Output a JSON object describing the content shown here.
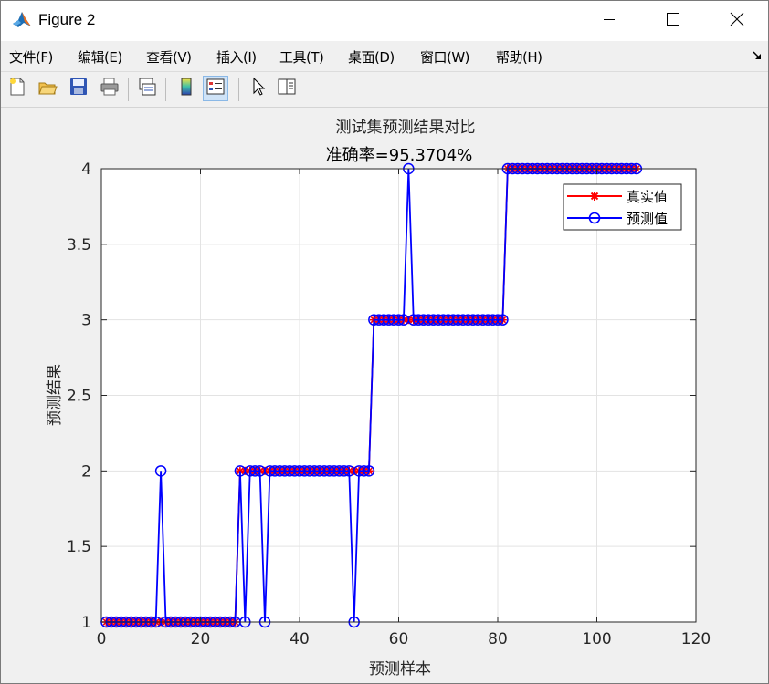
{
  "window": {
    "title": "Figure 2",
    "controls": [
      "minimize",
      "maximize",
      "close"
    ]
  },
  "menubar": {
    "items": [
      "文件(F)",
      "编辑(E)",
      "查看(V)",
      "插入(I)",
      "工具(T)",
      "桌面(D)",
      "窗口(W)",
      "帮助(H)"
    ]
  },
  "toolbar": {
    "buttons": [
      "new-figure-icon",
      "open-file-icon",
      "save-icon",
      "print-icon",
      "link-plot-icon",
      "colorbar-icon",
      "legend-icon",
      "pointer-icon",
      "property-editor-icon"
    ],
    "active": "legend-icon"
  },
  "colors": {
    "true_series": "#ff0000",
    "pred_series": "#0000ff",
    "grid": "#e3e3e3",
    "background": "#f0f0f0"
  },
  "chart_data": {
    "type": "line",
    "title": "测试集预测结果对比",
    "subtitle": "准确率=95.3704%",
    "xlabel": "预测样本",
    "ylabel": "预测结果",
    "xlim": [
      0,
      120
    ],
    "ylim": [
      1,
      4
    ],
    "xticks": [
      "0",
      "20",
      "40",
      "60",
      "80",
      "100",
      "120"
    ],
    "yticks": [
      "1",
      "1.5",
      "2",
      "2.5",
      "3",
      "3.5",
      "4"
    ],
    "grid": true,
    "legend_position": "top-right",
    "x": [
      1,
      2,
      3,
      4,
      5,
      6,
      7,
      8,
      9,
      10,
      11,
      12,
      13,
      14,
      15,
      16,
      17,
      18,
      19,
      20,
      21,
      22,
      23,
      24,
      25,
      26,
      27,
      28,
      29,
      30,
      31,
      32,
      33,
      34,
      35,
      36,
      37,
      38,
      39,
      40,
      41,
      42,
      43,
      44,
      45,
      46,
      47,
      48,
      49,
      50,
      51,
      52,
      53,
      54,
      55,
      56,
      57,
      58,
      59,
      60,
      61,
      62,
      63,
      64,
      65,
      66,
      67,
      68,
      69,
      70,
      71,
      72,
      73,
      74,
      75,
      76,
      77,
      78,
      79,
      80,
      81,
      82,
      83,
      84,
      85,
      86,
      87,
      88,
      89,
      90,
      91,
      92,
      93,
      94,
      95,
      96,
      97,
      98,
      99,
      100,
      101,
      102,
      103,
      104,
      105,
      106,
      107,
      108
    ],
    "series": [
      {
        "name": "真实值",
        "marker": "asterisk",
        "color": "#ff0000",
        "values": [
          1,
          1,
          1,
          1,
          1,
          1,
          1,
          1,
          1,
          1,
          1,
          1,
          1,
          1,
          1,
          1,
          1,
          1,
          1,
          1,
          1,
          1,
          1,
          1,
          1,
          1,
          1,
          2,
          2,
          2,
          2,
          2,
          2,
          2,
          2,
          2,
          2,
          2,
          2,
          2,
          2,
          2,
          2,
          2,
          2,
          2,
          2,
          2,
          2,
          2,
          2,
          2,
          2,
          2,
          3,
          3,
          3,
          3,
          3,
          3,
          3,
          3,
          3,
          3,
          3,
          3,
          3,
          3,
          3,
          3,
          3,
          3,
          3,
          3,
          3,
          3,
          3,
          3,
          3,
          3,
          3,
          4,
          4,
          4,
          4,
          4,
          4,
          4,
          4,
          4,
          4,
          4,
          4,
          4,
          4,
          4,
          4,
          4,
          4,
          4,
          4,
          4,
          4,
          4,
          4,
          4,
          4,
          4
        ]
      },
      {
        "name": "预测值",
        "marker": "circle",
        "color": "#0000ff",
        "values": [
          1,
          1,
          1,
          1,
          1,
          1,
          1,
          1,
          1,
          1,
          1,
          2,
          1,
          1,
          1,
          1,
          1,
          1,
          1,
          1,
          1,
          1,
          1,
          1,
          1,
          1,
          1,
          2,
          1,
          2,
          2,
          2,
          1,
          2,
          2,
          2,
          2,
          2,
          2,
          2,
          2,
          2,
          2,
          2,
          2,
          2,
          2,
          2,
          2,
          2,
          1,
          2,
          2,
          2,
          3,
          3,
          3,
          3,
          3,
          3,
          3,
          4,
          3,
          3,
          3,
          3,
          3,
          3,
          3,
          3,
          3,
          3,
          3,
          3,
          3,
          3,
          3,
          3,
          3,
          3,
          3,
          4,
          4,
          4,
          4,
          4,
          4,
          4,
          4,
          4,
          4,
          4,
          4,
          4,
          4,
          4,
          4,
          4,
          4,
          4,
          4,
          4,
          4,
          4,
          4,
          4,
          4,
          4
        ]
      }
    ]
  }
}
